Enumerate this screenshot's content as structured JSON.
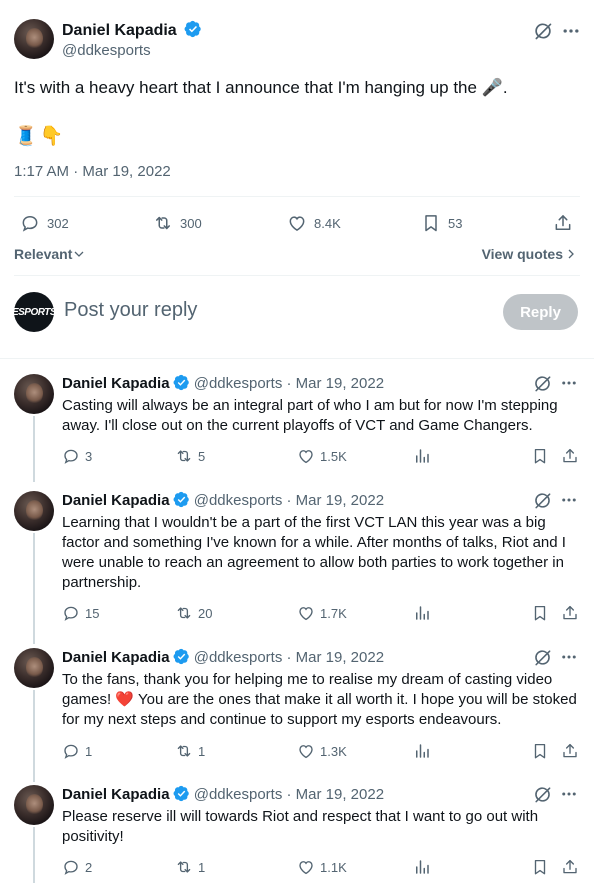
{
  "main_tweet": {
    "author_name": "Daniel Kapadia",
    "author_handle": "@ddkesports",
    "text": "It's with a heavy heart that I announce that I'm hanging up the",
    "text_end": ".",
    "emoji_inline": "🎤",
    "emoji_line": "🧵👇",
    "timestamp": "1:17 AM · Mar 19, 2022",
    "stats": {
      "replies": "302",
      "reposts": "300",
      "likes": "8.4K",
      "bookmarks": "53"
    }
  },
  "sort": {
    "label": "Relevant",
    "view_quotes": "View quotes"
  },
  "composer": {
    "avatar_text": "ESPORTS",
    "placeholder": "Post your reply",
    "button": "Reply"
  },
  "replies": [
    {
      "name": "Daniel Kapadia",
      "handle": "@ddkesports",
      "date": "· Mar 19, 2022",
      "text": "Casting will always be an integral part of who I am but for now I'm stepping away. I'll close out on the current playoffs of VCT and Game Changers.",
      "replies": "3",
      "reposts": "5",
      "likes": "1.5K"
    },
    {
      "name": "Daniel Kapadia",
      "handle": "@ddkesports",
      "date": "· Mar 19, 2022",
      "text": "Learning that I wouldn't be a part of the first VCT LAN this year was a big factor and something I've known for a while. After months of talks, Riot and I were unable to reach an agreement to allow both parties to work together in partnership.",
      "replies": "15",
      "reposts": "20",
      "likes": "1.7K"
    },
    {
      "name": "Daniel Kapadia",
      "handle": "@ddkesports",
      "date": "· Mar 19, 2022",
      "text_a": "To the fans, thank you for helping me to realise my dream of casting video games!",
      "heart": "❤️",
      "text_b": "You are the ones that make it all worth it. I hope you will be stoked for my next steps and continue to support my esports endeavours.",
      "replies": "1",
      "reposts": "1",
      "likes": "1.3K"
    },
    {
      "name": "Daniel Kapadia",
      "handle": "@ddkesports",
      "date": "· Mar 19, 2022",
      "text": "Please reserve ill will towards Riot and respect that I want to go out with positivity!",
      "replies": "2",
      "reposts": "1",
      "likes": "1.1K"
    }
  ],
  "colors": {
    "verified": "#1d9bf0",
    "muted": "#536471",
    "text": "#0f1419",
    "reply_button": "#bfc4c8"
  },
  "icons": [
    "verified-icon",
    "grok-icon",
    "more-icon",
    "reply-icon",
    "repost-icon",
    "like-icon",
    "bookmark-icon",
    "share-icon",
    "views-icon",
    "chevron-down-icon",
    "chevron-right-icon"
  ]
}
